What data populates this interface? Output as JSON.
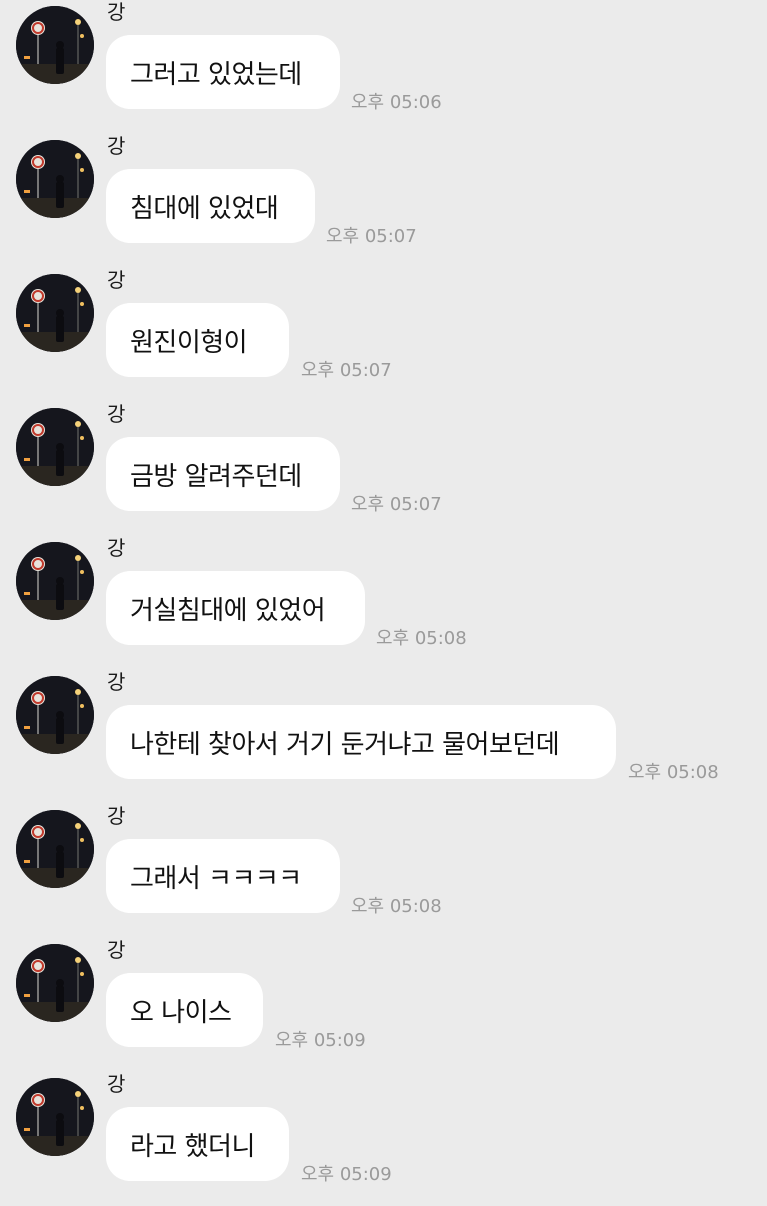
{
  "sender": "강",
  "messages": [
    {
      "text": "그러고 있었는데",
      "time": "오후 05:06"
    },
    {
      "text": "침대에 있었대",
      "time": "오후 05:07"
    },
    {
      "text": "원진이형이",
      "time": "오후 05:07"
    },
    {
      "text": "금방 알려주던데",
      "time": "오후 05:07"
    },
    {
      "text": "거실침대에 있었어",
      "time": "오후 05:08"
    },
    {
      "text": "나한테 찾아서 거기 둔거냐고 물어보던데",
      "time": "오후 05:08"
    },
    {
      "text": "그래서 ㅋㅋㅋㅋ",
      "time": "오후 05:08"
    },
    {
      "text": "오 나이스",
      "time": "오후 05:09"
    },
    {
      "text": "라고 했더니",
      "time": "오후 05:09"
    }
  ],
  "colors": {
    "background": "#ebebeb",
    "bubble": "#ffffff",
    "time_text": "#9a9a9a"
  },
  "icons": {
    "avatar": "profile-photo-night-street"
  }
}
